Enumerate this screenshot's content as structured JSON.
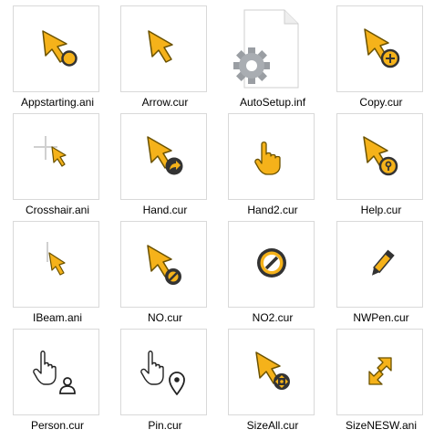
{
  "colors": {
    "cursor_fill": "#F5B21A",
    "cursor_outline": "#6B5200",
    "badge_dark": "#333333",
    "thumb_border": "#D9D9D9"
  },
  "files": [
    {
      "name": "Appstarting.ani",
      "icon": "appstarting-cursor-icon"
    },
    {
      "name": "Arrow.cur",
      "icon": "arrow-cursor-icon"
    },
    {
      "name": "AutoSetup.inf",
      "icon": "settings-file-icon"
    },
    {
      "name": "Copy.cur",
      "icon": "copy-cursor-icon"
    },
    {
      "name": "Crosshair.ani",
      "icon": "crosshair-cursor-icon"
    },
    {
      "name": "Hand.cur",
      "icon": "hand-link-cursor-icon"
    },
    {
      "name": "Hand2.cur",
      "icon": "pointing-hand-cursor-icon"
    },
    {
      "name": "Help.cur",
      "icon": "help-cursor-icon"
    },
    {
      "name": "IBeam.ani",
      "icon": "ibeam-cursor-icon"
    },
    {
      "name": "NO.cur",
      "icon": "no-cursor-icon"
    },
    {
      "name": "NO2.cur",
      "icon": "no2-cursor-icon"
    },
    {
      "name": "NWPen.cur",
      "icon": "pen-cursor-icon"
    },
    {
      "name": "Person.cur",
      "icon": "person-cursor-icon"
    },
    {
      "name": "Pin.cur",
      "icon": "pin-cursor-icon"
    },
    {
      "name": "SizeAll.cur",
      "icon": "move-cursor-icon"
    },
    {
      "name": "SizeNESW.ani",
      "icon": "diagonal-resize-cursor-icon"
    }
  ]
}
